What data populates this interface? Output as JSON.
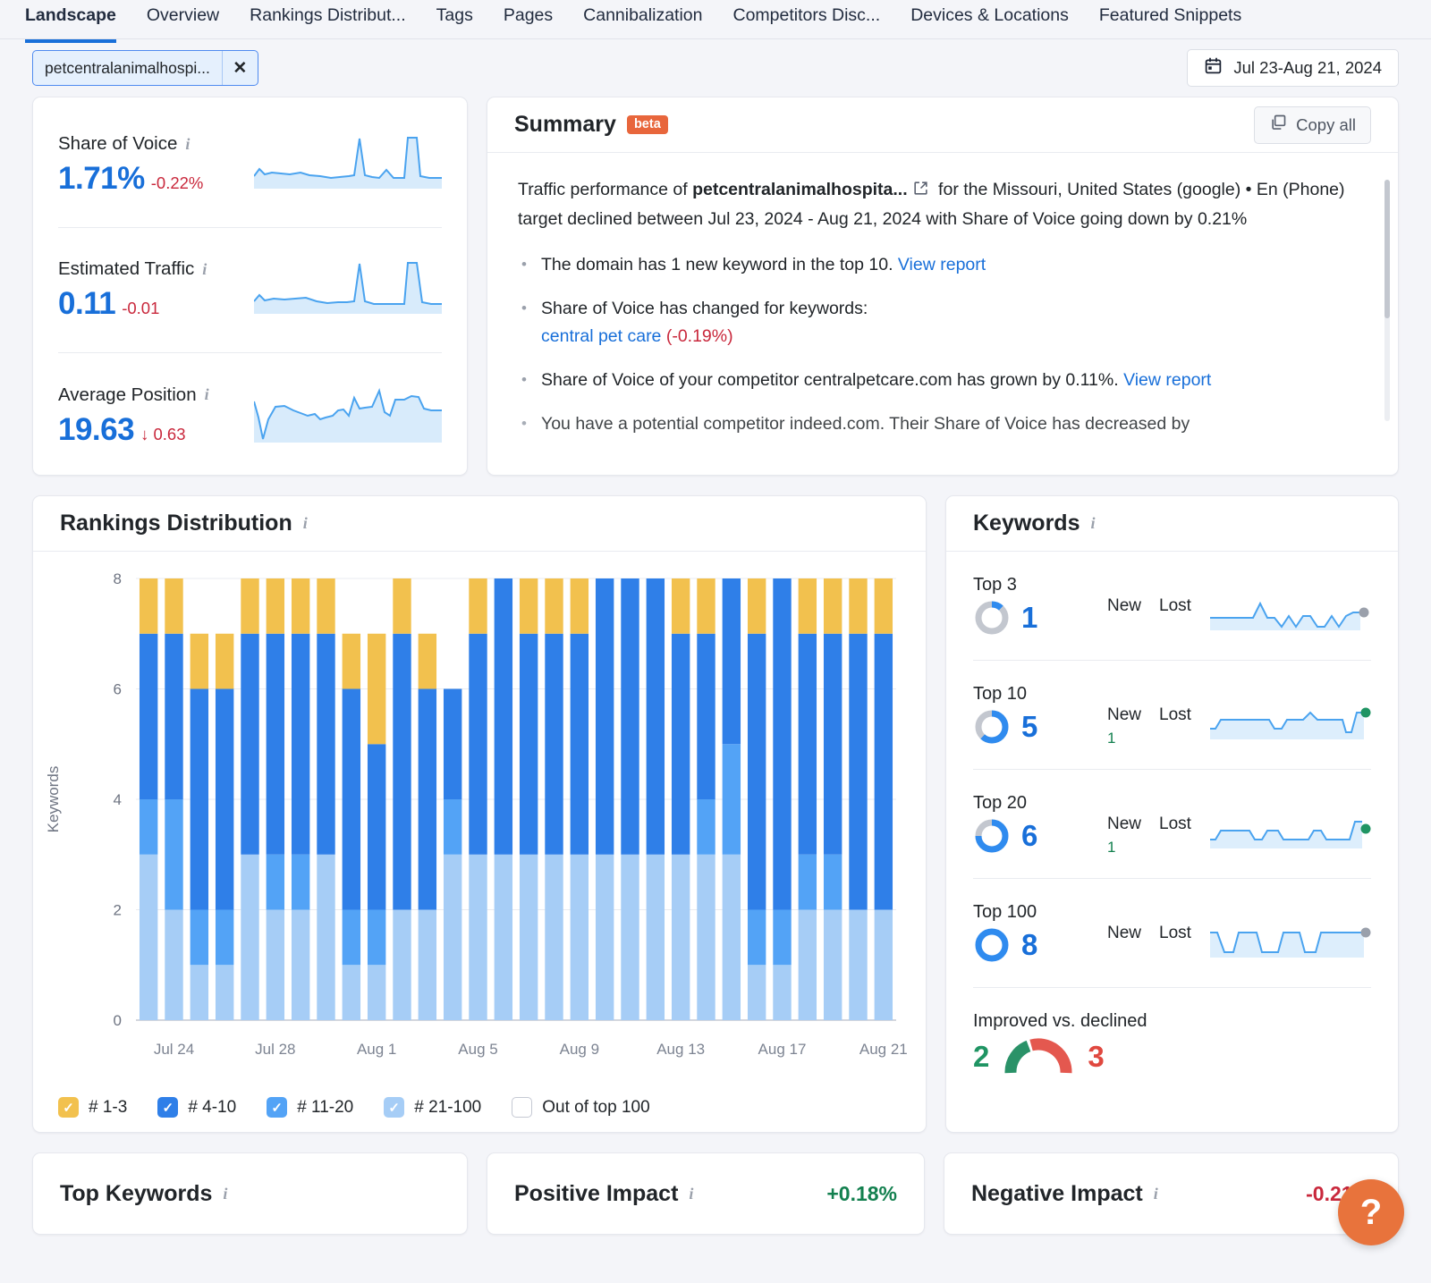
{
  "tabs": [
    {
      "label": "Landscape",
      "active": true
    },
    {
      "label": "Overview",
      "active": false
    },
    {
      "label": "Rankings Distribut...",
      "active": false
    },
    {
      "label": "Tags",
      "active": false
    },
    {
      "label": "Pages",
      "active": false
    },
    {
      "label": "Cannibalization",
      "active": false
    },
    {
      "label": "Competitors Disc...",
      "active": false
    },
    {
      "label": "Devices & Locations",
      "active": false
    },
    {
      "label": "Featured Snippets",
      "active": false
    }
  ],
  "filters": {
    "domain_chip": "petcentralanimalhospi...",
    "close_label": "✕",
    "date_range": "Jul 23-Aug 21, 2024"
  },
  "metrics": [
    {
      "title": "Share of Voice",
      "value": "1.71%",
      "delta": "-0.22%"
    },
    {
      "title": "Estimated Traffic",
      "value": "0.11",
      "delta": "-0.01"
    },
    {
      "title": "Average Position",
      "value": "19.63",
      "delta": "↓ 0.63"
    }
  ],
  "summary": {
    "title": "Summary",
    "badge": "beta",
    "copy_label": "Copy all",
    "intro_pre": "Traffic performance of ",
    "intro_bold": "petcentralanimalhospita...",
    "intro_post": " for the Missouri, United States (google) • En (Phone) target declined between Jul 23, 2024 - Aug 21, 2024 with Share of Voice going down by 0.21%",
    "bullets": [
      {
        "text": "The domain has 1 new keyword in the top 10. ",
        "link": "View report"
      },
      {
        "text": "Share of Voice has changed for keywords:",
        "keyword": "central pet care",
        "change": "(-0.19%)"
      },
      {
        "text": "Share of Voice of your competitor centralpetcare.com has grown by 0.11%. ",
        "link": "View report"
      },
      {
        "text": "You have a potential competitor indeed.com. Their Share of Voice has decreased by"
      }
    ]
  },
  "rankings": {
    "title": "Rankings Distribution",
    "legend": [
      {
        "label": "# 1-3",
        "color": "#f2c14e",
        "checked": true
      },
      {
        "label": "# 4-10",
        "color": "#2f7fe8",
        "checked": true
      },
      {
        "label": "# 11-20",
        "color": "#53a3f6",
        "checked": true
      },
      {
        "label": "# 21-100",
        "color": "#a6cdf6",
        "checked": true
      },
      {
        "label": "Out of top 100",
        "color": "#ffffff",
        "checked": false
      }
    ]
  },
  "chart_data": {
    "type": "bar",
    "title": "Rankings Distribution",
    "xlabel": "",
    "ylabel": "Keywords",
    "ylim": [
      0,
      8
    ],
    "yticks": [
      0,
      2,
      4,
      6,
      8
    ],
    "grid": true,
    "stacked": true,
    "legend_position": "bottom",
    "tick_labels": [
      "Jul 24",
      "Jul 28",
      "Aug 1",
      "Aug 5",
      "Aug 9",
      "Aug 13",
      "Aug 17",
      "Aug 21"
    ],
    "categories": [
      "Jul 23",
      "Jul 24",
      "Jul 25",
      "Jul 26",
      "Jul 27",
      "Jul 28",
      "Jul 29",
      "Jul 30",
      "Jul 31",
      "Aug 1",
      "Aug 2",
      "Aug 3",
      "Aug 4",
      "Aug 5",
      "Aug 6",
      "Aug 7",
      "Aug 8",
      "Aug 9",
      "Aug 10",
      "Aug 11",
      "Aug 12",
      "Aug 13",
      "Aug 14",
      "Aug 15",
      "Aug 16",
      "Aug 17",
      "Aug 18",
      "Aug 19",
      "Aug 20",
      "Aug 21"
    ],
    "series": [
      {
        "name": "# 21-100",
        "color": "#a6cdf6",
        "values": [
          3,
          2,
          1,
          1,
          3,
          2,
          2,
          3,
          1,
          1,
          2,
          2,
          3,
          3,
          3,
          3,
          3,
          3,
          3,
          3,
          3,
          3,
          3,
          3,
          1,
          1,
          2,
          2,
          2,
          2
        ]
      },
      {
        "name": "# 11-20",
        "color": "#53a3f6",
        "values": [
          1,
          2,
          1,
          1,
          0,
          1,
          1,
          0,
          1,
          1,
          0,
          0,
          1,
          0,
          0,
          0,
          0,
          0,
          0,
          0,
          0,
          0,
          1,
          2,
          1,
          1,
          1,
          1,
          0,
          0
        ]
      },
      {
        "name": "# 4-10",
        "color": "#2f7fe8",
        "values": [
          3,
          3,
          4,
          4,
          4,
          4,
          4,
          4,
          4,
          3,
          5,
          4,
          2,
          4,
          5,
          4,
          4,
          4,
          5,
          5,
          5,
          4,
          3,
          3,
          5,
          6,
          4,
          4,
          5,
          5
        ]
      },
      {
        "name": "# 1-3",
        "color": "#f2c14e",
        "values": [
          1,
          1,
          1,
          1,
          1,
          1,
          1,
          1,
          1,
          2,
          1,
          1,
          0,
          1,
          0,
          1,
          1,
          1,
          0,
          0,
          0,
          1,
          1,
          0,
          1,
          0,
          1,
          1,
          1,
          1
        ]
      }
    ]
  },
  "keywords": {
    "title": "Keywords",
    "rows": [
      {
        "label": "Top 3",
        "value": "1",
        "new_label": "New",
        "lost_label": "Lost",
        "new_value": "",
        "lost_value": "",
        "ring_pct": 12,
        "dot_color": "#9aa0ab"
      },
      {
        "label": "Top 10",
        "value": "5",
        "new_label": "New",
        "lost_label": "Lost",
        "new_value": "1",
        "lost_value": "",
        "ring_pct": 62,
        "dot_color": "#1f9463"
      },
      {
        "label": "Top 20",
        "value": "6",
        "new_label": "New",
        "lost_label": "Lost",
        "new_value": "1",
        "lost_value": "",
        "ring_pct": 75,
        "dot_color": "#1f9463"
      },
      {
        "label": "Top 100",
        "value": "8",
        "new_label": "New",
        "lost_label": "Lost",
        "new_value": "",
        "lost_value": "",
        "ring_pct": 100,
        "dot_color": "#9aa0ab"
      }
    ],
    "improved": {
      "label": "Improved vs. declined",
      "improved_value": "2",
      "declined_value": "3"
    }
  },
  "footer": {
    "top_keywords": "Top Keywords",
    "positive_impact": "Positive Impact",
    "positive_value": "+0.18%",
    "negative_impact": "Negative Impact",
    "negative_value": "-0.21%"
  },
  "help": {
    "label": "?"
  }
}
